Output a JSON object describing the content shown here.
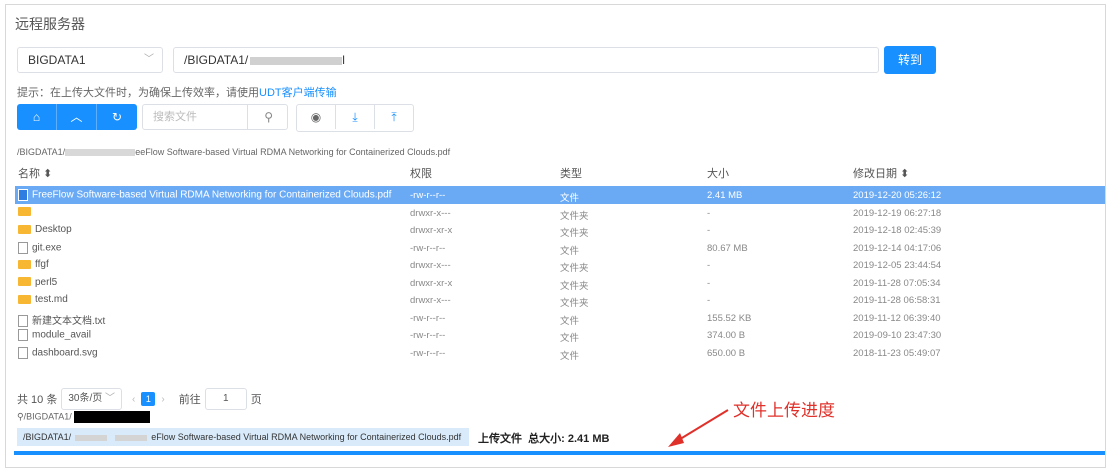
{
  "panel_title": "远程服务器",
  "server_select": {
    "value": "BIGDATA1"
  },
  "path_input": {
    "prefix": "/BIGDATA1/",
    "suffix": "l"
  },
  "goto_label": "转到",
  "hint": {
    "text": "提示：在上传大文件时，为确保上传效率，请使用",
    "link": "UDT客户端传输"
  },
  "search": {
    "placeholder": "搜索文件"
  },
  "breadcrumb": {
    "prefix": "/BIGDATA1/",
    "suffix": "eeFlow Software-based Virtual RDMA Networking for Containerized Clouds.pdf"
  },
  "table": {
    "headers": {
      "name": "名称 ⬍",
      "perm": "权限",
      "type": "类型",
      "size": "大小",
      "date": "修改日期 ⬍"
    },
    "rows": [
      {
        "name": "FreeFlow Software-based Virtual RDMA Networking for Containerized Clouds.pdf",
        "perm": "-rw-r--r--",
        "type": "文件",
        "size": "2.41 MB",
        "date": "2019-12-20 05:26:12"
      },
      {
        "name": "",
        "perm": "drwxr-x---",
        "type": "文件夹",
        "size": "-",
        "date": "2019-12-19 06:27:18"
      },
      {
        "name": "Desktop",
        "perm": "drwxr-xr-x",
        "type": "文件夹",
        "size": "-",
        "date": "2019-12-18 02:45:39"
      },
      {
        "name": "git.exe",
        "perm": "-rw-r--r--",
        "type": "文件",
        "size": "80.67 MB",
        "date": "2019-12-14 04:17:06"
      },
      {
        "name": "ffgf",
        "perm": "drwxr-x---",
        "type": "文件夹",
        "size": "-",
        "date": "2019-12-05 23:44:54"
      },
      {
        "name": "perl5",
        "perm": "drwxr-xr-x",
        "type": "文件夹",
        "size": "-",
        "date": "2019-11-28 07:05:34"
      },
      {
        "name": "test.md",
        "perm": "drwxr-x---",
        "type": "文件夹",
        "size": "-",
        "date": "2019-11-28 06:58:31"
      },
      {
        "name": "新建文本文档.txt",
        "perm": "-rw-r--r--",
        "type": "文件",
        "size": "155.52 KB",
        "date": "2019-11-12 06:39:40"
      },
      {
        "name": "module_avail",
        "perm": "-rw-r--r--",
        "type": "文件",
        "size": "374.00 B",
        "date": "2019-09-10 23:47:30"
      },
      {
        "name": "dashboard.svg",
        "perm": "-rw-r--r--",
        "type": "文件",
        "size": "650.00 B",
        "date": "2018-11-23 05:49:07"
      }
    ]
  },
  "pagination": {
    "total": "共 10 条",
    "per_page": "30条/页",
    "current_page": "1",
    "goto_prefix": "前往",
    "goto_value": "1",
    "goto_suffix": "页"
  },
  "local_path": "/BIGDATA1/",
  "upload": {
    "file_prefix": "/BIGDATA1/",
    "file_suffix": "eFlow Software-based Virtual RDMA Networking for Containerized Clouds.pdf",
    "label": "上传文件",
    "total_label": "总大小:",
    "total_size": "2.41 MB",
    "progress": 1.0
  },
  "annotation": "文件上传进度",
  "colors": {
    "accent": "#1890ff",
    "selected_row": "#6aaaf5",
    "annotation": "#e0302a",
    "folder": "#f7b733"
  }
}
